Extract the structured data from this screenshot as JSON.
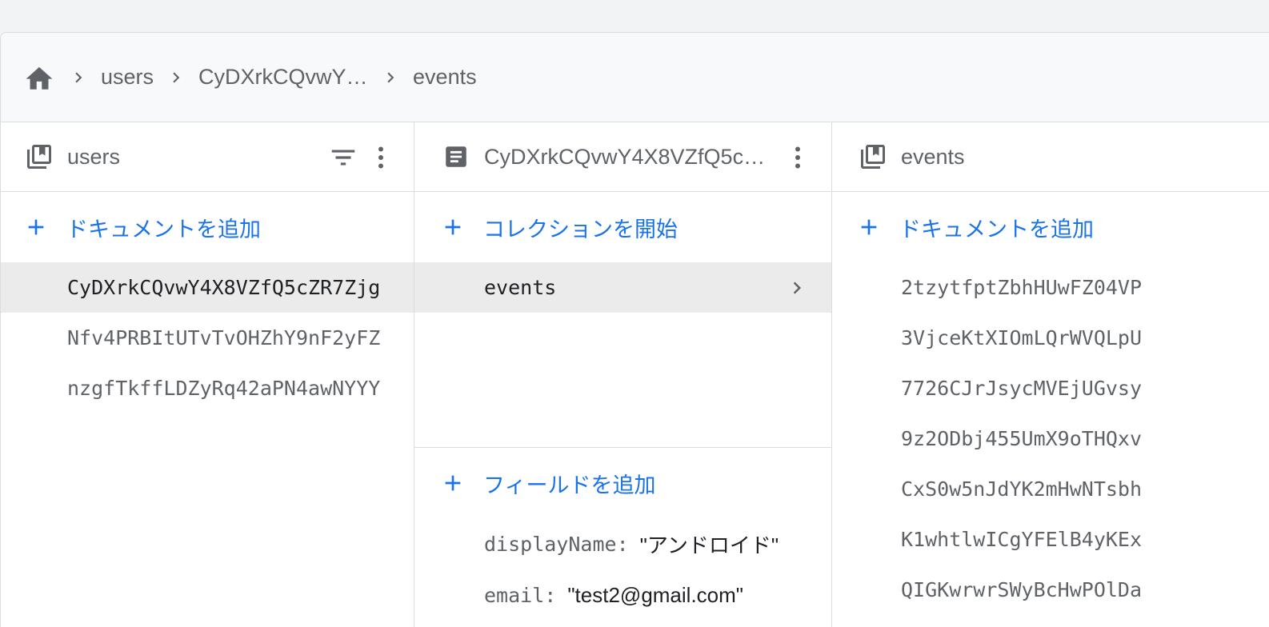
{
  "breadcrumb": {
    "items": [
      "users",
      "CyDXrkCQvwY4...",
      "events"
    ]
  },
  "columns": {
    "users": {
      "title": "users",
      "add_label": "ドキュメントを追加",
      "documents": [
        "CyDXrkCQvwY4X8VZfQ5cZR7Zjg",
        "Nfv4PRBItUTvTvOHZhY9nF2yFZ",
        "nzgfTkffLDZyRq42aPN4awNYYY"
      ],
      "selected_index": 0
    },
    "document": {
      "title": "CyDXrkCQvwY4X8VZfQ5cZ...",
      "start_collection_label": "コレクションを開始",
      "subcollections": [
        "events"
      ],
      "add_field_label": "フィールドを追加",
      "fields": [
        {
          "key": "displayName",
          "value": "\"アンドロイド\""
        },
        {
          "key": "email",
          "value": "\"test2@gmail.com\""
        }
      ]
    },
    "events": {
      "title": "events",
      "add_label": "ドキュメントを追加",
      "documents": [
        "2tzytfptZbhHUwFZ04VP",
        "3VjceKtXIOmLQrWVQLpU",
        "7726CJrJsycMVEjUGvsy",
        "9z2ODbj455UmX9oTHQxv",
        "CxS0w5nJdYK2mHwNTsbh",
        "K1whtlwICgYFElB4yKEx",
        "QIGKwrwrSWyBcHwPOlDa"
      ]
    }
  },
  "colors": {
    "accent": "#1a73e8",
    "selected_bg": "#ebebeb",
    "text_secondary": "#5f6368",
    "border": "#dadce0"
  },
  "icons": {
    "home": "home-icon",
    "separator": "chevron-right-icon",
    "collection": "collection-icon",
    "document": "document-icon",
    "filter": "filter-icon",
    "more": "more-vert-icon",
    "add": "plus-icon"
  }
}
